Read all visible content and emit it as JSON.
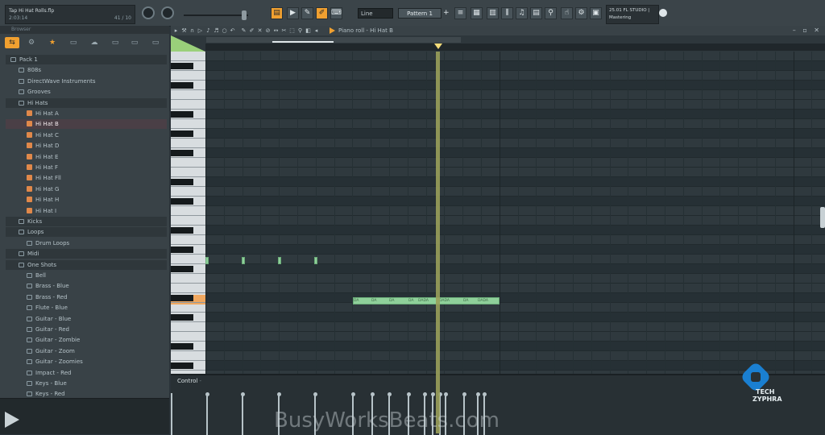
{
  "topbar": {
    "hint_line1": "Tap Hi Hat Rolls.flp",
    "hint_line2": "2:03:14",
    "hint_counter": "41 / 10",
    "snap": "Line",
    "pattern": "Pattern 1",
    "pattern_add": "+",
    "info_line1": "25.01  FL STUDIO |",
    "info_line2": "Mastering"
  },
  "browser": {
    "header": "Browser",
    "items": [
      {
        "label": "Pack 1",
        "depth": 0,
        "kind": "folder"
      },
      {
        "label": "808s",
        "depth": 1,
        "kind": "folder"
      },
      {
        "label": "DirectWave Instruments",
        "depth": 1,
        "kind": "folder"
      },
      {
        "label": "Grooves",
        "depth": 1,
        "kind": "folder"
      },
      {
        "label": "Hi Hats",
        "depth": 1,
        "kind": "folder"
      },
      {
        "label": "Hi Hat A",
        "depth": 2,
        "kind": "wave"
      },
      {
        "label": "Hi Hat B",
        "depth": 2,
        "kind": "wave",
        "selected": true
      },
      {
        "label": "Hi Hat C",
        "depth": 2,
        "kind": "wave"
      },
      {
        "label": "Hi Hat D",
        "depth": 2,
        "kind": "wave"
      },
      {
        "label": "Hi Hat E",
        "depth": 2,
        "kind": "wave"
      },
      {
        "label": "Hi Hat F",
        "depth": 2,
        "kind": "wave"
      },
      {
        "label": "Hi Hat Fll",
        "depth": 2,
        "kind": "wave"
      },
      {
        "label": "Hi Hat G",
        "depth": 2,
        "kind": "wave"
      },
      {
        "label": "Hi Hat H",
        "depth": 2,
        "kind": "wave"
      },
      {
        "label": "Hi Hat I",
        "depth": 2,
        "kind": "wave"
      },
      {
        "label": "Kicks",
        "depth": 1,
        "kind": "folder"
      },
      {
        "label": "Loops",
        "depth": 1,
        "kind": "folder"
      },
      {
        "label": "Drum Loops",
        "depth": 2,
        "kind": "folder"
      },
      {
        "label": "Midi",
        "depth": 1,
        "kind": "folder"
      },
      {
        "label": "One Shots",
        "depth": 1,
        "kind": "folder"
      },
      {
        "label": "Bell",
        "depth": 2,
        "kind": "folder"
      },
      {
        "label": "Brass - Blue",
        "depth": 2,
        "kind": "folder"
      },
      {
        "label": "Brass - Red",
        "depth": 2,
        "kind": "folder"
      },
      {
        "label": "Flute - Blue",
        "depth": 2,
        "kind": "folder"
      },
      {
        "label": "Guitar - Blue",
        "depth": 2,
        "kind": "folder"
      },
      {
        "label": "Guitar - Red",
        "depth": 2,
        "kind": "folder"
      },
      {
        "label": "Guitar - Zombie",
        "depth": 2,
        "kind": "folder"
      },
      {
        "label": "Guitar - Zoom",
        "depth": 2,
        "kind": "folder"
      },
      {
        "label": "Guitar - Zoomies",
        "depth": 2,
        "kind": "folder"
      },
      {
        "label": "Impact - Red",
        "depth": 2,
        "kind": "folder"
      },
      {
        "label": "Keys - Blue",
        "depth": 2,
        "kind": "folder"
      },
      {
        "label": "Keys - Red",
        "depth": 2,
        "kind": "folder"
      }
    ]
  },
  "piano_roll": {
    "title": "Piano roll - Hi Hat B",
    "note_label": "DA",
    "note_label_dense": "DADA",
    "control_label": "Control",
    "control_suffix": "-"
  },
  "watermark": "BusyWorksBeats.com",
  "logo": {
    "line1": "TECH",
    "line2": "ZYPHRA"
  }
}
